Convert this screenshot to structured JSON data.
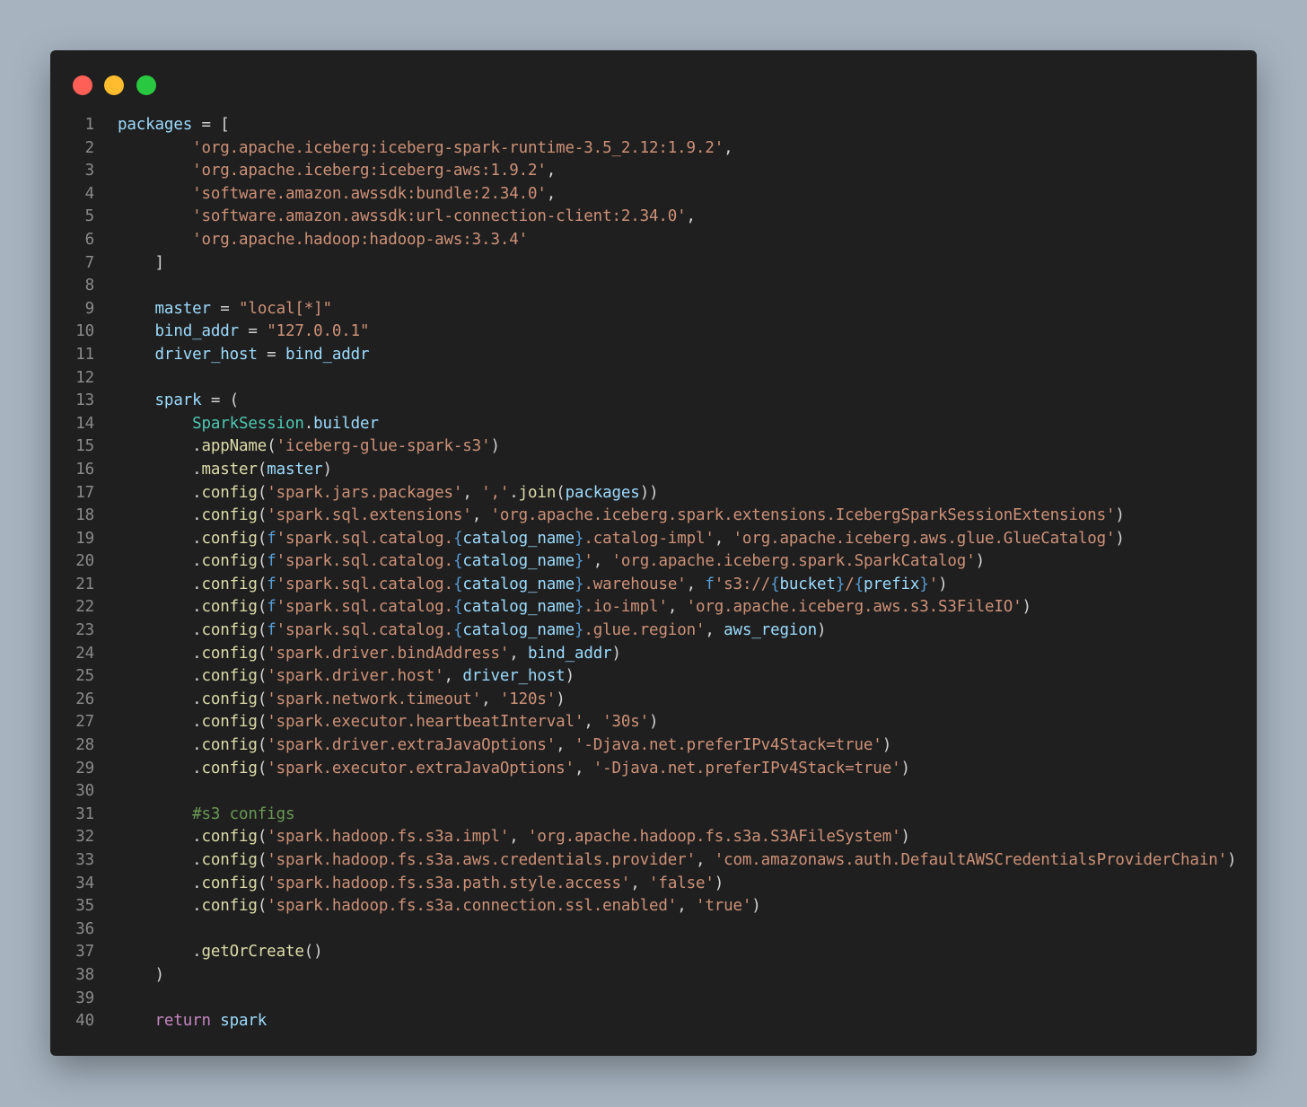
{
  "window": {
    "controls": [
      "close",
      "minimize",
      "maximize"
    ],
    "colors": {
      "close": "#fe5f57",
      "minimize": "#febc2e",
      "maximize": "#28c840"
    }
  },
  "code": {
    "lines": [
      {
        "n": "1",
        "tokens": [
          [
            "var",
            "packages"
          ],
          [
            "pun",
            " = ["
          ]
        ]
      },
      {
        "n": "2",
        "tokens": [
          [
            "pun",
            "        "
          ],
          [
            "str",
            "'org.apache.iceberg:iceberg-spark-runtime-3.5_2.12:1.9.2'"
          ],
          [
            "pun",
            ","
          ]
        ]
      },
      {
        "n": "3",
        "tokens": [
          [
            "pun",
            "        "
          ],
          [
            "str",
            "'org.apache.iceberg:iceberg-aws:1.9.2'"
          ],
          [
            "pun",
            ","
          ]
        ]
      },
      {
        "n": "4",
        "tokens": [
          [
            "pun",
            "        "
          ],
          [
            "str",
            "'software.amazon.awssdk:bundle:2.34.0'"
          ],
          [
            "pun",
            ","
          ]
        ]
      },
      {
        "n": "5",
        "tokens": [
          [
            "pun",
            "        "
          ],
          [
            "str",
            "'software.amazon.awssdk:url-connection-client:2.34.0'"
          ],
          [
            "pun",
            ","
          ]
        ]
      },
      {
        "n": "6",
        "tokens": [
          [
            "pun",
            "        "
          ],
          [
            "str",
            "'org.apache.hadoop:hadoop-aws:3.3.4'"
          ]
        ]
      },
      {
        "n": "7",
        "tokens": [
          [
            "pun",
            "    ]"
          ]
        ]
      },
      {
        "n": "8",
        "tokens": []
      },
      {
        "n": "9",
        "tokens": [
          [
            "pun",
            "    "
          ],
          [
            "var",
            "master"
          ],
          [
            "pun",
            " = "
          ],
          [
            "str",
            "\"local[*]\""
          ]
        ]
      },
      {
        "n": "10",
        "tokens": [
          [
            "pun",
            "    "
          ],
          [
            "var",
            "bind_addr"
          ],
          [
            "pun",
            " = "
          ],
          [
            "str",
            "\"127.0.0.1\""
          ]
        ]
      },
      {
        "n": "11",
        "tokens": [
          [
            "pun",
            "    "
          ],
          [
            "var",
            "driver_host"
          ],
          [
            "pun",
            " = "
          ],
          [
            "var",
            "bind_addr"
          ]
        ]
      },
      {
        "n": "12",
        "tokens": []
      },
      {
        "n": "13",
        "tokens": [
          [
            "pun",
            "    "
          ],
          [
            "var",
            "spark"
          ],
          [
            "pun",
            " = ("
          ]
        ]
      },
      {
        "n": "14",
        "tokens": [
          [
            "pun",
            "        "
          ],
          [
            "cls",
            "SparkSession"
          ],
          [
            "pun",
            "."
          ],
          [
            "var",
            "builder"
          ]
        ]
      },
      {
        "n": "15",
        "tokens": [
          [
            "pun",
            "        ."
          ],
          [
            "fn",
            "appName"
          ],
          [
            "pun",
            "("
          ],
          [
            "str",
            "'iceberg-glue-spark-s3'"
          ],
          [
            "pun",
            ")"
          ]
        ]
      },
      {
        "n": "16",
        "tokens": [
          [
            "pun",
            "        ."
          ],
          [
            "fn",
            "master"
          ],
          [
            "pun",
            "("
          ],
          [
            "var",
            "master"
          ],
          [
            "pun",
            ")"
          ]
        ]
      },
      {
        "n": "17",
        "tokens": [
          [
            "pun",
            "        ."
          ],
          [
            "fn",
            "config"
          ],
          [
            "pun",
            "("
          ],
          [
            "str",
            "'spark.jars.packages'"
          ],
          [
            "pun",
            ", "
          ],
          [
            "str",
            "','"
          ],
          [
            "pun",
            "."
          ],
          [
            "fn",
            "join"
          ],
          [
            "pun",
            "("
          ],
          [
            "var",
            "packages"
          ],
          [
            "pun",
            "))"
          ]
        ]
      },
      {
        "n": "18",
        "tokens": [
          [
            "pun",
            "        ."
          ],
          [
            "fn",
            "config"
          ],
          [
            "pun",
            "("
          ],
          [
            "str",
            "'spark.sql.extensions'"
          ],
          [
            "pun",
            ", "
          ],
          [
            "str",
            "'org.apache.iceberg.spark.extensions.IcebergSparkSessionExtensions'"
          ],
          [
            "pun",
            ")"
          ]
        ]
      },
      {
        "n": "19",
        "tokens": [
          [
            "pun",
            "        ."
          ],
          [
            "fn",
            "config"
          ],
          [
            "pun",
            "("
          ],
          [
            "fpre",
            "f"
          ],
          [
            "str",
            "'spark.sql.catalog."
          ],
          [
            "brc",
            "{"
          ],
          [
            "var",
            "catalog_name"
          ],
          [
            "brc",
            "}"
          ],
          [
            "str",
            ".catalog-impl'"
          ],
          [
            "pun",
            ", "
          ],
          [
            "str",
            "'org.apache.iceberg.aws.glue.GlueCatalog'"
          ],
          [
            "pun",
            ")"
          ]
        ]
      },
      {
        "n": "20",
        "tokens": [
          [
            "pun",
            "        ."
          ],
          [
            "fn",
            "config"
          ],
          [
            "pun",
            "("
          ],
          [
            "fpre",
            "f"
          ],
          [
            "str",
            "'spark.sql.catalog."
          ],
          [
            "brc",
            "{"
          ],
          [
            "var",
            "catalog_name"
          ],
          [
            "brc",
            "}"
          ],
          [
            "str",
            "'"
          ],
          [
            "pun",
            ", "
          ],
          [
            "str",
            "'org.apache.iceberg.spark.SparkCatalog'"
          ],
          [
            "pun",
            ")"
          ]
        ]
      },
      {
        "n": "21",
        "tokens": [
          [
            "pun",
            "        ."
          ],
          [
            "fn",
            "config"
          ],
          [
            "pun",
            "("
          ],
          [
            "fpre",
            "f"
          ],
          [
            "str",
            "'spark.sql.catalog."
          ],
          [
            "brc",
            "{"
          ],
          [
            "var",
            "catalog_name"
          ],
          [
            "brc",
            "}"
          ],
          [
            "str",
            ".warehouse'"
          ],
          [
            "pun",
            ", "
          ],
          [
            "fpre",
            "f"
          ],
          [
            "str",
            "'s3://"
          ],
          [
            "brc",
            "{"
          ],
          [
            "var",
            "bucket"
          ],
          [
            "brc",
            "}"
          ],
          [
            "str",
            "/"
          ],
          [
            "brc",
            "{"
          ],
          [
            "var",
            "prefix"
          ],
          [
            "brc",
            "}"
          ],
          [
            "str",
            "'"
          ],
          [
            "pun",
            ")"
          ]
        ]
      },
      {
        "n": "22",
        "tokens": [
          [
            "pun",
            "        ."
          ],
          [
            "fn",
            "config"
          ],
          [
            "pun",
            "("
          ],
          [
            "fpre",
            "f"
          ],
          [
            "str",
            "'spark.sql.catalog."
          ],
          [
            "brc",
            "{"
          ],
          [
            "var",
            "catalog_name"
          ],
          [
            "brc",
            "}"
          ],
          [
            "str",
            ".io-impl'"
          ],
          [
            "pun",
            ", "
          ],
          [
            "str",
            "'org.apache.iceberg.aws.s3.S3FileIO'"
          ],
          [
            "pun",
            ")"
          ]
        ]
      },
      {
        "n": "23",
        "tokens": [
          [
            "pun",
            "        ."
          ],
          [
            "fn",
            "config"
          ],
          [
            "pun",
            "("
          ],
          [
            "fpre",
            "f"
          ],
          [
            "str",
            "'spark.sql.catalog."
          ],
          [
            "brc",
            "{"
          ],
          [
            "var",
            "catalog_name"
          ],
          [
            "brc",
            "}"
          ],
          [
            "str",
            ".glue.region'"
          ],
          [
            "pun",
            ", "
          ],
          [
            "var",
            "aws_region"
          ],
          [
            "pun",
            ")"
          ]
        ]
      },
      {
        "n": "24",
        "tokens": [
          [
            "pun",
            "        ."
          ],
          [
            "fn",
            "config"
          ],
          [
            "pun",
            "("
          ],
          [
            "str",
            "'spark.driver.bindAddress'"
          ],
          [
            "pun",
            ", "
          ],
          [
            "var",
            "bind_addr"
          ],
          [
            "pun",
            ")"
          ]
        ]
      },
      {
        "n": "25",
        "tokens": [
          [
            "pun",
            "        ."
          ],
          [
            "fn",
            "config"
          ],
          [
            "pun",
            "("
          ],
          [
            "str",
            "'spark.driver.host'"
          ],
          [
            "pun",
            ", "
          ],
          [
            "var",
            "driver_host"
          ],
          [
            "pun",
            ")"
          ]
        ]
      },
      {
        "n": "26",
        "tokens": [
          [
            "pun",
            "        ."
          ],
          [
            "fn",
            "config"
          ],
          [
            "pun",
            "("
          ],
          [
            "str",
            "'spark.network.timeout'"
          ],
          [
            "pun",
            ", "
          ],
          [
            "str",
            "'120s'"
          ],
          [
            "pun",
            ")"
          ]
        ]
      },
      {
        "n": "27",
        "tokens": [
          [
            "pun",
            "        ."
          ],
          [
            "fn",
            "config"
          ],
          [
            "pun",
            "("
          ],
          [
            "str",
            "'spark.executor.heartbeatInterval'"
          ],
          [
            "pun",
            ", "
          ],
          [
            "str",
            "'30s'"
          ],
          [
            "pun",
            ")"
          ]
        ]
      },
      {
        "n": "28",
        "tokens": [
          [
            "pun",
            "        ."
          ],
          [
            "fn",
            "config"
          ],
          [
            "pun",
            "("
          ],
          [
            "str",
            "'spark.driver.extraJavaOptions'"
          ],
          [
            "pun",
            ", "
          ],
          [
            "str",
            "'-Djava.net.preferIPv4Stack=true'"
          ],
          [
            "pun",
            ")"
          ]
        ]
      },
      {
        "n": "29",
        "tokens": [
          [
            "pun",
            "        ."
          ],
          [
            "fn",
            "config"
          ],
          [
            "pun",
            "("
          ],
          [
            "str",
            "'spark.executor.extraJavaOptions'"
          ],
          [
            "pun",
            ", "
          ],
          [
            "str",
            "'-Djava.net.preferIPv4Stack=true'"
          ],
          [
            "pun",
            ")"
          ]
        ]
      },
      {
        "n": "30",
        "tokens": []
      },
      {
        "n": "31",
        "tokens": [
          [
            "pun",
            "        "
          ],
          [
            "cmt",
            "#s3 configs"
          ]
        ]
      },
      {
        "n": "32",
        "tokens": [
          [
            "pun",
            "        ."
          ],
          [
            "fn",
            "config"
          ],
          [
            "pun",
            "("
          ],
          [
            "str",
            "'spark.hadoop.fs.s3a.impl'"
          ],
          [
            "pun",
            ", "
          ],
          [
            "str",
            "'org.apache.hadoop.fs.s3a.S3AFileSystem'"
          ],
          [
            "pun",
            ")"
          ]
        ]
      },
      {
        "n": "33",
        "tokens": [
          [
            "pun",
            "        ."
          ],
          [
            "fn",
            "config"
          ],
          [
            "pun",
            "("
          ],
          [
            "str",
            "'spark.hadoop.fs.s3a.aws.credentials.provider'"
          ],
          [
            "pun",
            ", "
          ],
          [
            "str",
            "'com.amazonaws.auth.DefaultAWSCredentialsProviderChain'"
          ],
          [
            "pun",
            ")"
          ]
        ]
      },
      {
        "n": "34",
        "tokens": [
          [
            "pun",
            "        ."
          ],
          [
            "fn",
            "config"
          ],
          [
            "pun",
            "("
          ],
          [
            "str",
            "'spark.hadoop.fs.s3a.path.style.access'"
          ],
          [
            "pun",
            ", "
          ],
          [
            "str",
            "'false'"
          ],
          [
            "pun",
            ")"
          ]
        ]
      },
      {
        "n": "35",
        "tokens": [
          [
            "pun",
            "        ."
          ],
          [
            "fn",
            "config"
          ],
          [
            "pun",
            "("
          ],
          [
            "str",
            "'spark.hadoop.fs.s3a.connection.ssl.enabled'"
          ],
          [
            "pun",
            ", "
          ],
          [
            "str",
            "'true'"
          ],
          [
            "pun",
            ")"
          ]
        ]
      },
      {
        "n": "36",
        "tokens": []
      },
      {
        "n": "37",
        "tokens": [
          [
            "pun",
            "        ."
          ],
          [
            "fn",
            "getOrCreate"
          ],
          [
            "pun",
            "()"
          ]
        ]
      },
      {
        "n": "38",
        "tokens": [
          [
            "pun",
            "    )"
          ]
        ]
      },
      {
        "n": "39",
        "tokens": []
      },
      {
        "n": "40",
        "tokens": [
          [
            "pun",
            "    "
          ],
          [
            "kw",
            "return"
          ],
          [
            "pun",
            " "
          ],
          [
            "var",
            "spark"
          ]
        ]
      }
    ]
  }
}
